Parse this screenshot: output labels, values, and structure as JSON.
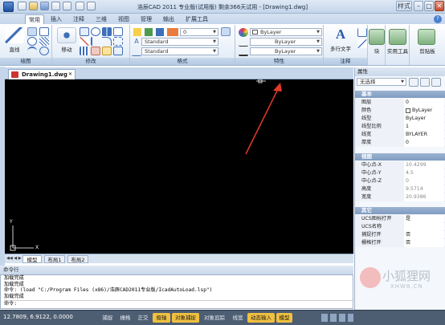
{
  "window": {
    "title": "浩辰CAD 2011 专业版(试用版) 剩余366天试用 - [Drawing1.dwg]",
    "menu_label": "样式"
  },
  "ribbon_tabs": [
    "常用",
    "插入",
    "注释",
    "三维",
    "视图",
    "管理",
    "输出",
    "扩展工具"
  ],
  "ribbon": {
    "draw": {
      "label": "绘图",
      "line": "直线"
    },
    "modify": {
      "label": "修改",
      "move": "移动"
    },
    "format": {
      "label": "格式",
      "layer_value": "0",
      "style1": "Standard",
      "style2": "Standard",
      "style3": "Standard"
    },
    "properties": {
      "label": "特性",
      "color": "ByLayer",
      "linetype": "ByLayer",
      "lineweight": "ByLayer"
    },
    "annotation": {
      "label": "注释",
      "mtext": "多行文字"
    },
    "block": {
      "label": "块"
    },
    "tools": {
      "label": "实用工具"
    },
    "clipboard": {
      "label": "剪贴板"
    }
  },
  "document": {
    "tab": "Drawing1.dwg"
  },
  "canvas": {
    "axis_x": "X",
    "axis_y": "Y"
  },
  "layout_tabs": [
    "模型",
    "布局1",
    "布局2"
  ],
  "command": {
    "title": "命令行",
    "lines": [
      "加载完成",
      "加载完成",
      "命令: (load \"C:/Program Files (x86)/浩辰CAD2011专业版/IcadAutoLoad.lsp\")",
      "加载完成"
    ],
    "prompt": "命令:"
  },
  "status": {
    "coords": "12.7809, 6.9122, 0.0000",
    "buttons": [
      "捕捉",
      "栅格",
      "正交",
      "极轴",
      "对象捕捉",
      "对象追踪",
      "线宽",
      "动态输入",
      "模型"
    ],
    "active": [
      3,
      4,
      7,
      8
    ]
  },
  "properties_panel": {
    "title": "属性",
    "selection": "无选择",
    "sections": [
      {
        "name": "基本",
        "rows": [
          [
            "图层",
            "0"
          ],
          [
            "颜色",
            "ByLayer"
          ],
          [
            "线型",
            "ByLayer"
          ],
          [
            "线型比例",
            "1"
          ],
          [
            "线宽",
            "BYLAYER"
          ],
          [
            "厚度",
            "0"
          ]
        ]
      },
      {
        "name": "视图",
        "rows": [
          [
            "中心点-X",
            "10.4299"
          ],
          [
            "中心点-Y",
            "4.5"
          ],
          [
            "中心点-Z",
            "0"
          ],
          [
            "高度",
            "9.5714"
          ],
          [
            "宽度",
            "20.9386"
          ]
        ]
      },
      {
        "name": "其它",
        "rows": [
          [
            "UCS图标打开",
            "是"
          ],
          [
            "UCS名称",
            ""
          ],
          [
            "捕捉打开",
            "否"
          ],
          [
            "栅格打开",
            "否"
          ]
        ]
      }
    ]
  },
  "watermark": {
    "text": "小狐狸网",
    "sub": "XHW8.CN"
  },
  "colors": {
    "accent": "#f0c040",
    "ribbon": "#dde8f5",
    "canvas": "#000000",
    "arrow": "#e23a2a"
  }
}
